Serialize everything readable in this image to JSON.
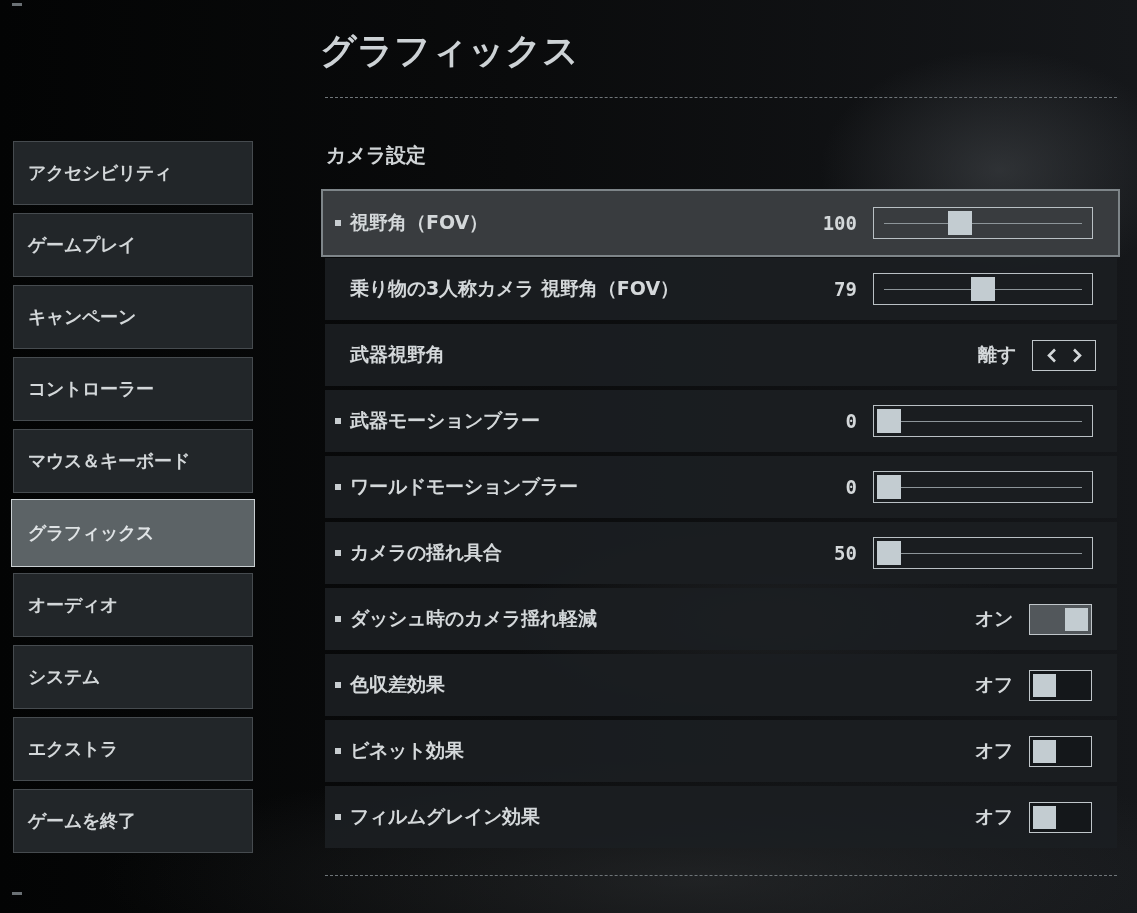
{
  "title": "グラフィックス",
  "sidebar": {
    "items": [
      {
        "label": "アクセシビリティ",
        "selected": false
      },
      {
        "label": "ゲームプレイ",
        "selected": false
      },
      {
        "label": "キャンペーン",
        "selected": false
      },
      {
        "label": "コントローラー",
        "selected": false
      },
      {
        "label": "マウス＆キーボード",
        "selected": false
      },
      {
        "label": "グラフィックス",
        "selected": true
      },
      {
        "label": "オーディオ",
        "selected": false
      },
      {
        "label": "システム",
        "selected": false
      },
      {
        "label": "エクストラ",
        "selected": false
      },
      {
        "label": "ゲームを終了",
        "selected": false
      }
    ]
  },
  "section": {
    "heading": "カメラ設定",
    "rows": [
      {
        "kind": "slider",
        "label": "視野角（FOV）",
        "marked": true,
        "selected": true,
        "value": "100",
        "level": 0.38
      },
      {
        "kind": "slider",
        "label": "乗り物の3人称カメラ 視野角（FOV）",
        "marked": false,
        "selected": false,
        "value": "79",
        "level": 0.5
      },
      {
        "kind": "selector",
        "label": "武器視野角",
        "marked": false,
        "selected": false,
        "value": "離す"
      },
      {
        "kind": "slider",
        "label": "武器モーションブラー",
        "marked": true,
        "selected": false,
        "value": "0",
        "level": 0
      },
      {
        "kind": "slider",
        "label": "ワールドモーションブラー",
        "marked": true,
        "selected": false,
        "value": "0",
        "level": 0
      },
      {
        "kind": "slider",
        "label": "カメラの揺れ具合",
        "marked": true,
        "selected": false,
        "value": "50",
        "level": 0
      },
      {
        "kind": "toggle",
        "label": "ダッシュ時のカメラ揺れ軽減",
        "marked": true,
        "selected": false,
        "value": "オン",
        "on": true
      },
      {
        "kind": "toggle",
        "label": "色収差効果",
        "marked": true,
        "selected": false,
        "value": "オフ",
        "on": false
      },
      {
        "kind": "toggle",
        "label": "ビネット効果",
        "marked": true,
        "selected": false,
        "value": "オフ",
        "on": false
      },
      {
        "kind": "toggle",
        "label": "フィルムグレイン効果",
        "marked": true,
        "selected": false,
        "value": "オフ",
        "on": false
      }
    ]
  }
}
